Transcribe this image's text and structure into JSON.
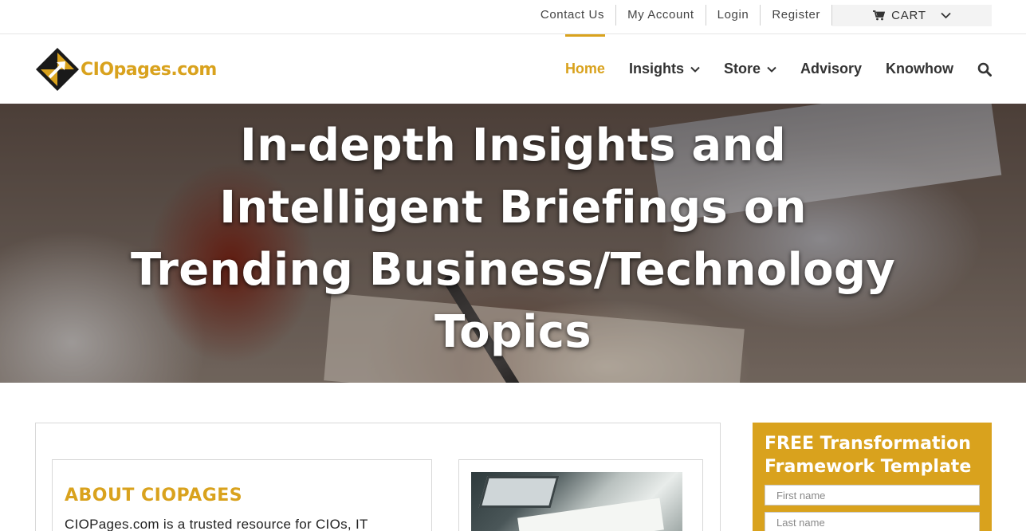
{
  "topbar": {
    "links": [
      "Contact Us",
      "My Account",
      "Login",
      "Register"
    ],
    "cart_label": "CART"
  },
  "header": {
    "logo_text": "CIOpages.com",
    "nav": {
      "home": "Home",
      "insights": "Insights",
      "store": "Store",
      "advisory": "Advisory",
      "knowhow": "Knowhow"
    }
  },
  "hero": {
    "title": "In-depth Insights and Intelligent Briefings on Trending Business/Technology Topics"
  },
  "about": {
    "title": "ABOUT CIOPAGES",
    "text": "CIOPages.com is a trusted resource for CIOs, IT"
  },
  "sidebar": {
    "title": "FREE Transformation Framework Template",
    "first_name_placeholder": "First name",
    "last_name_placeholder": "Last name"
  },
  "colors": {
    "accent": "#d9a21d",
    "nav_text": "#333333",
    "hero_text": "#ffffff"
  },
  "icons": [
    "cart-icon",
    "chevron-down-icon",
    "search-icon",
    "logo-mark-icon"
  ]
}
